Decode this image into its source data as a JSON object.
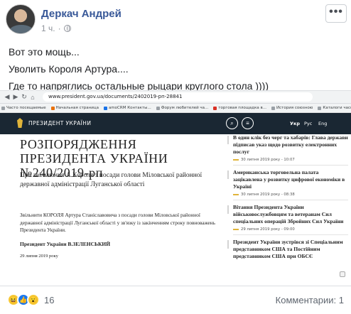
{
  "post": {
    "author": "Деркач Андрей",
    "time": "1 ч.",
    "more_label": "•••",
    "lines": [
      "Вот это мощь...",
      "Уволить Короля Артура....",
      "Где то напряглись остальные рыцари круглого стола ))))"
    ]
  },
  "screenshot": {
    "browser": {
      "url": "www.president.gov.ua/documents/2402019-рп-28841",
      "bookmarks": [
        {
          "label": "Часто посещаемые",
          "color": "#9aa0a6"
        },
        {
          "label": "Начальная страница",
          "color": "#e8710a"
        },
        {
          "label": "amoCRM Контакты...",
          "color": "#1a73e8"
        },
        {
          "label": "Форум любителей ча...",
          "color": "#9aa0a6"
        },
        {
          "label": "торговая площадка в...",
          "color": "#d93025"
        },
        {
          "label": "История союзною",
          "color": "#9aa0a6"
        },
        {
          "label": "Каталоги часов СССР...",
          "color": "#9aa0a6"
        },
        {
          "label": "Новая вкладка",
          "color": "#9aa0a6"
        }
      ]
    },
    "site": {
      "title": "ПРЕЗИДЕНТ УКРАЇНИ",
      "languages": [
        "Укр",
        "Рус",
        "Eng"
      ],
      "search_icon": "search-icon",
      "menu_icon": "menu-icon"
    },
    "document": {
      "title": "РОЗПОРЯДЖЕННЯ ПРЕЗИДЕНТА УКРАЇНИ №240/2019-рп",
      "subtitle": "Про звільнення А.Короля з посади голови Міловської районної державної адміністрації Луганської області",
      "body": "Звільнити КОРОЛЯ Артура Станіславовича з посади голови Міловської районної державної адміністрації Луганської області у зв'язку із закінченням строку повноважень Президента України.",
      "signature": "Президент України В.ЗЕЛЕНСЬКИЙ",
      "date": "29 липня 2019 року"
    },
    "news": [
      {
        "title": "В один клік без черг та хабарів: Глава держави підписав указ щодо розвитку електронних послуг",
        "date": "30 липня 2019 року - 10:07"
      },
      {
        "title": "Американська торговельна палата зацікавлена у розвитку цифрової економіки в Україні",
        "date": "30 липня 2019 року - 08:38"
      },
      {
        "title": "Вітання Президента України військовослужбовцям та ветеранам Сил спеціальних операцій Збройних Сил України",
        "date": "29 липня 2019 року - 09:00"
      },
      {
        "title": "Президент України зустрівся зі Спеціальним представником США та Постійним представником США при ОБСЄ",
        "date": ""
      }
    ]
  },
  "footer": {
    "reaction_count": "16",
    "comments_label": "Комментарии: 1"
  },
  "colors": {
    "link": "#385898",
    "site_header": "#1a2733",
    "accent": "#e0b43a"
  }
}
